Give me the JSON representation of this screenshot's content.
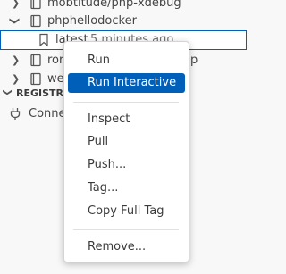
{
  "tree": {
    "item_mobtitude": "mobtitude/php-xdebug",
    "item_phphello": "phphellodocker",
    "item_latest_tag": "latest",
    "item_latest_time": "5 minutes ago",
    "item_ror_suffix": "ror",
    "item_ror_tail": "p",
    "item_we": "we"
  },
  "registries": {
    "header": "REGISTRIES",
    "connect_label": "Conne"
  },
  "context_menu": {
    "run": "Run",
    "run_interactive": "Run Interactive",
    "inspect": "Inspect",
    "pull": "Pull",
    "push": "Push...",
    "tag": "Tag...",
    "copy_full_tag": "Copy Full Tag",
    "remove": "Remove..."
  },
  "colors": {
    "accent": "#005fb8",
    "menu_bg": "#ffffff",
    "sidebar_bg": "#f8f8f8"
  }
}
